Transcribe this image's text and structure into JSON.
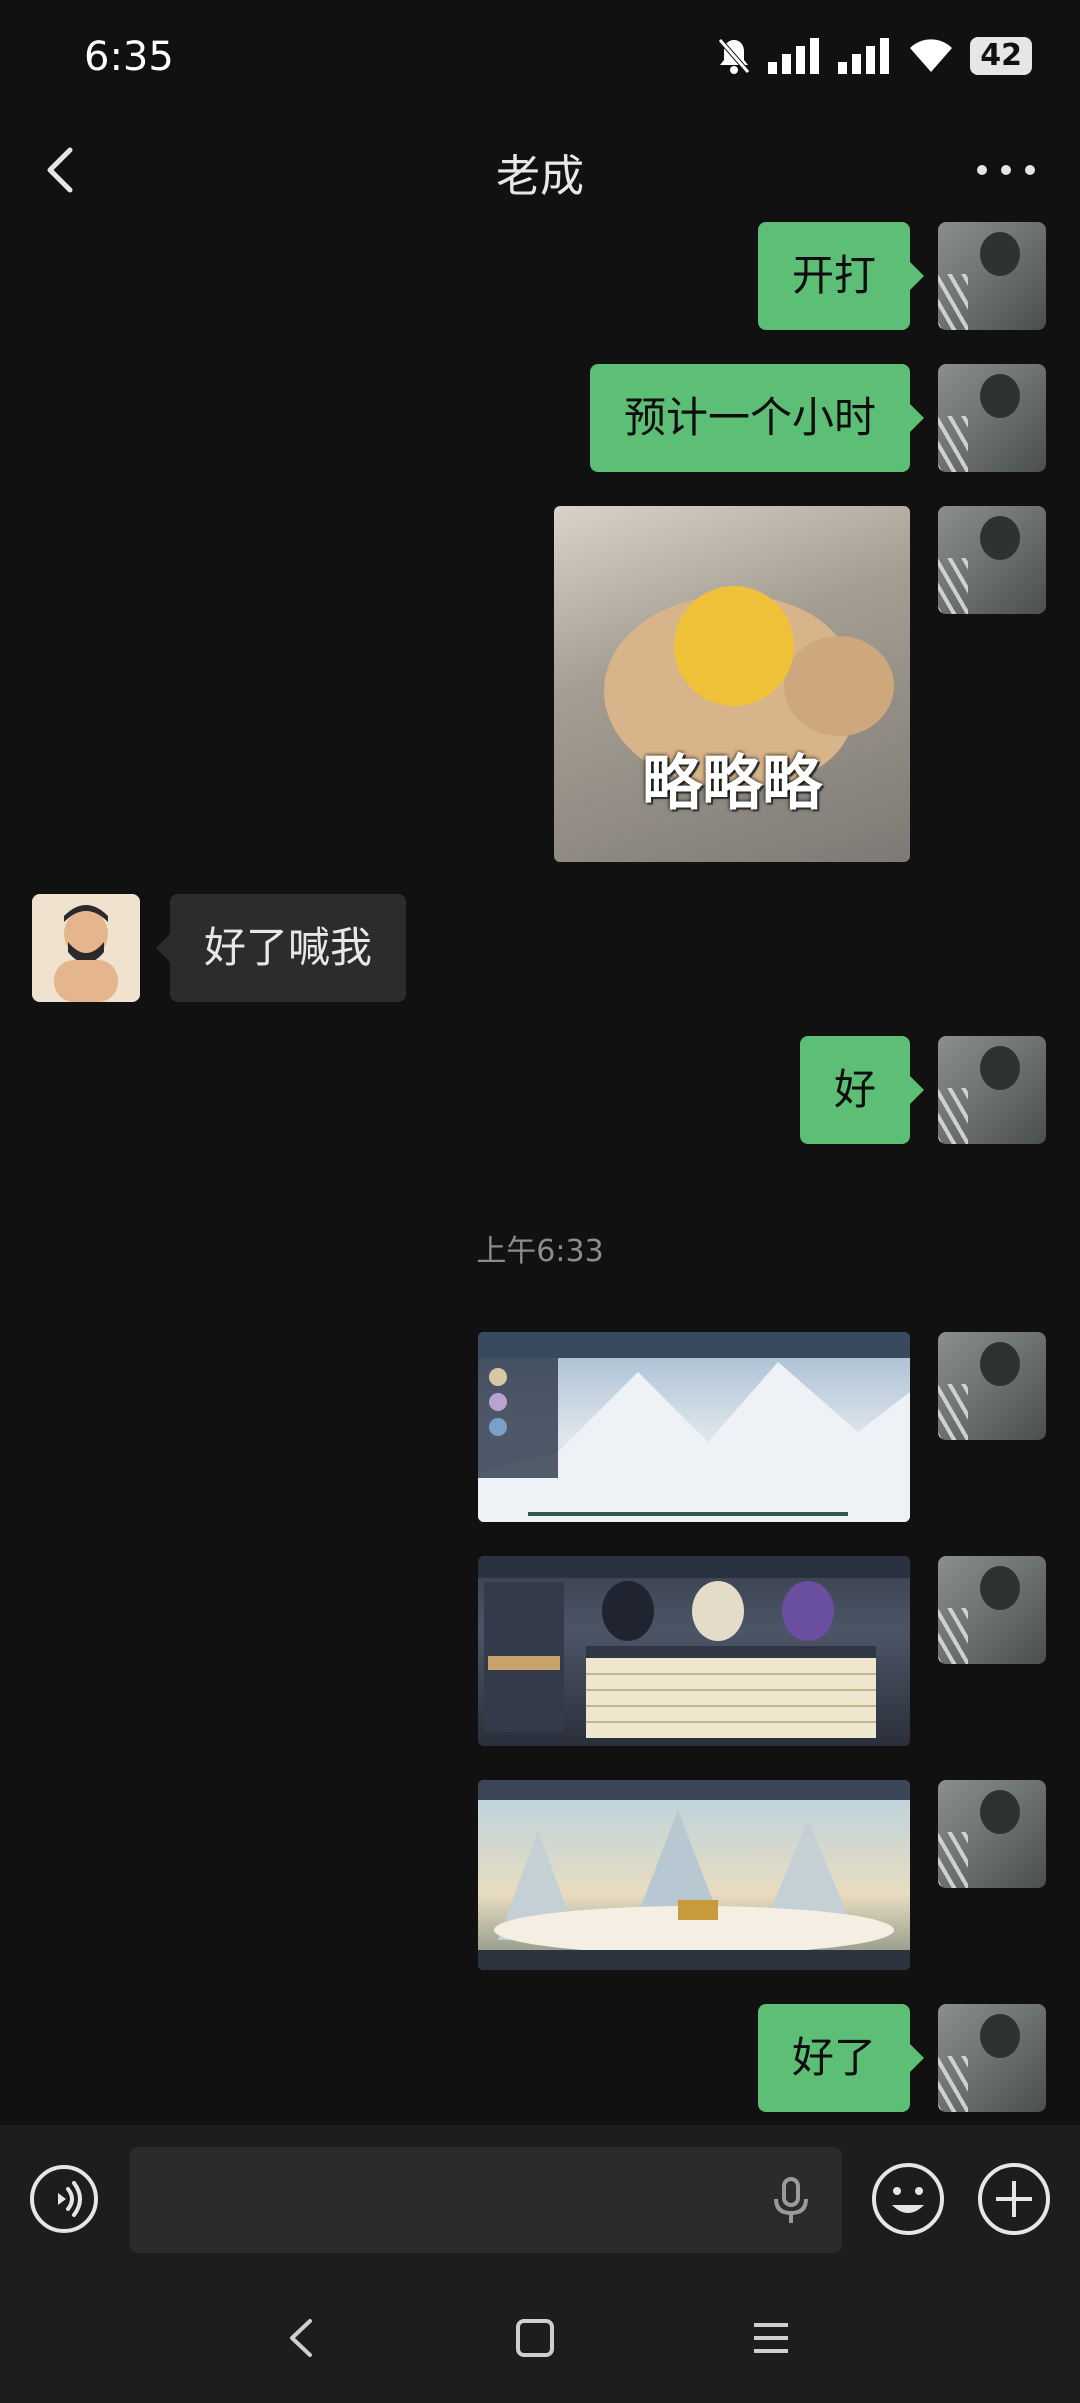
{
  "status_bar": {
    "time": "6:35",
    "battery": "42"
  },
  "nav": {
    "title": "老成"
  },
  "messages": {
    "m1": "开打",
    "m2": "预计一个小时",
    "m3_image_caption": "略略略",
    "m4_friend": "好了喊我",
    "m5": "好",
    "timestamp": "上午6:33",
    "m9": "好了"
  },
  "icons": {
    "back": "chevron-left-icon",
    "more": "more-horizontal-icon",
    "voice": "voice-input-icon",
    "mic": "microphone-icon",
    "emoji": "emoji-icon",
    "plus": "plus-icon",
    "mute": "bell-off-icon",
    "wifi": "wifi-icon"
  },
  "colors": {
    "background": "#111111",
    "bubble_sent": "#5dbe75",
    "bubble_received": "#2c2c2c"
  }
}
